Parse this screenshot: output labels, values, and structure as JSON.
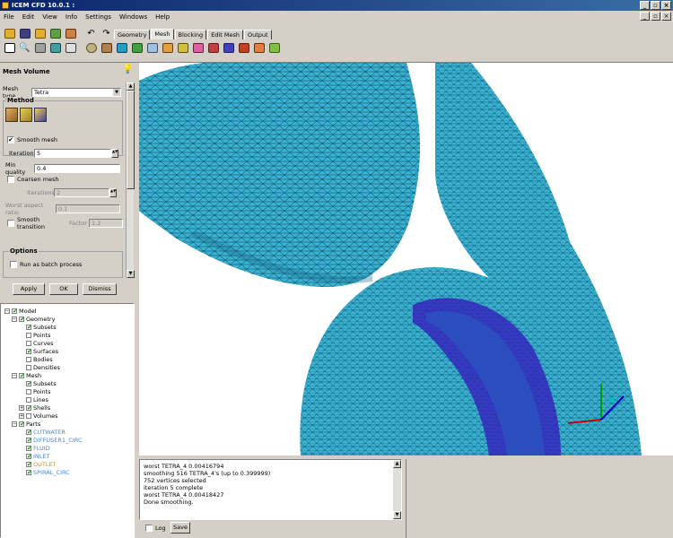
{
  "window": {
    "title": "ICEM CFD 10.0.1 :",
    "min_glyph": "_",
    "max_glyph": "▫",
    "close_glyph": "×"
  },
  "menu": [
    "File",
    "Edit",
    "View",
    "Info",
    "Settings",
    "Windows",
    "Help"
  ],
  "tabs": [
    "Geometry",
    "Mesh",
    "Blocking",
    "Edit Mesh",
    "Output"
  ],
  "active_tab": "Mesh",
  "panel": {
    "title": "Mesh Volume",
    "mesh_type_label": "Mesh type",
    "mesh_type_value": "Tetra",
    "method_label": "Method",
    "smooth_mesh_label": "Smooth mesh",
    "smooth_mesh_checked": true,
    "check_glyph": "✔",
    "iterations_label": "Iterations",
    "iterations_value": "5",
    "min_quality_label": "Min quality",
    "min_quality_value": "0.4",
    "coarsen_label": "Coarsen mesh",
    "coarsen_checked": false,
    "coarsen_iterations_label": "Iterations",
    "coarsen_iterations_value": "2",
    "worst_aspect_label": "Worst aspect ratio",
    "worst_aspect_value": "0.1",
    "smooth_transition_label": "Smooth transition",
    "factor_label": "Factor",
    "factor_value": "1.2",
    "options_label": "Options",
    "batch_label": "Run as batch process",
    "apply_label": "Apply",
    "ok_label": "OK",
    "dismiss_label": "Dismiss"
  },
  "tree": {
    "model": "Model",
    "geometry": "Geometry",
    "geometry_children": [
      "Subsets",
      "Points",
      "Curves",
      "Surfaces",
      "Bodies",
      "Densities"
    ],
    "mesh": "Mesh",
    "mesh_children": [
      "Subsets",
      "Points",
      "Lines",
      "Shells",
      "Volumes"
    ],
    "parts": "Parts",
    "parts_children": [
      {
        "name": "CUTWATER",
        "color": "#4a8ad0"
      },
      {
        "name": "DIFFUSER1_CIRC",
        "color": "#4a8ad0"
      },
      {
        "name": "FLUID",
        "color": "#4a8ad0"
      },
      {
        "name": "INLET",
        "color": "#4a8ad0"
      },
      {
        "name": "OUTLET",
        "color": "#d09020"
      },
      {
        "name": "SPIRAL_CIRC",
        "color": "#4a8ad0"
      }
    ]
  },
  "console": {
    "lines": [
      "worst TETRA_4 0.00416794",
      "smoothing 516 TETRA_4's (up to 0.399999)",
      "752 vertices selected",
      "iteration 5 complete",
      "worst TETRA_4 0.00418427",
      "Done smoothing."
    ],
    "log_label": "Log",
    "save_label": "Save"
  },
  "colors": {
    "mesh_surface": "#3ab4d4",
    "inner_surface": "#3838c8",
    "grid_line": "#0a3a50"
  }
}
